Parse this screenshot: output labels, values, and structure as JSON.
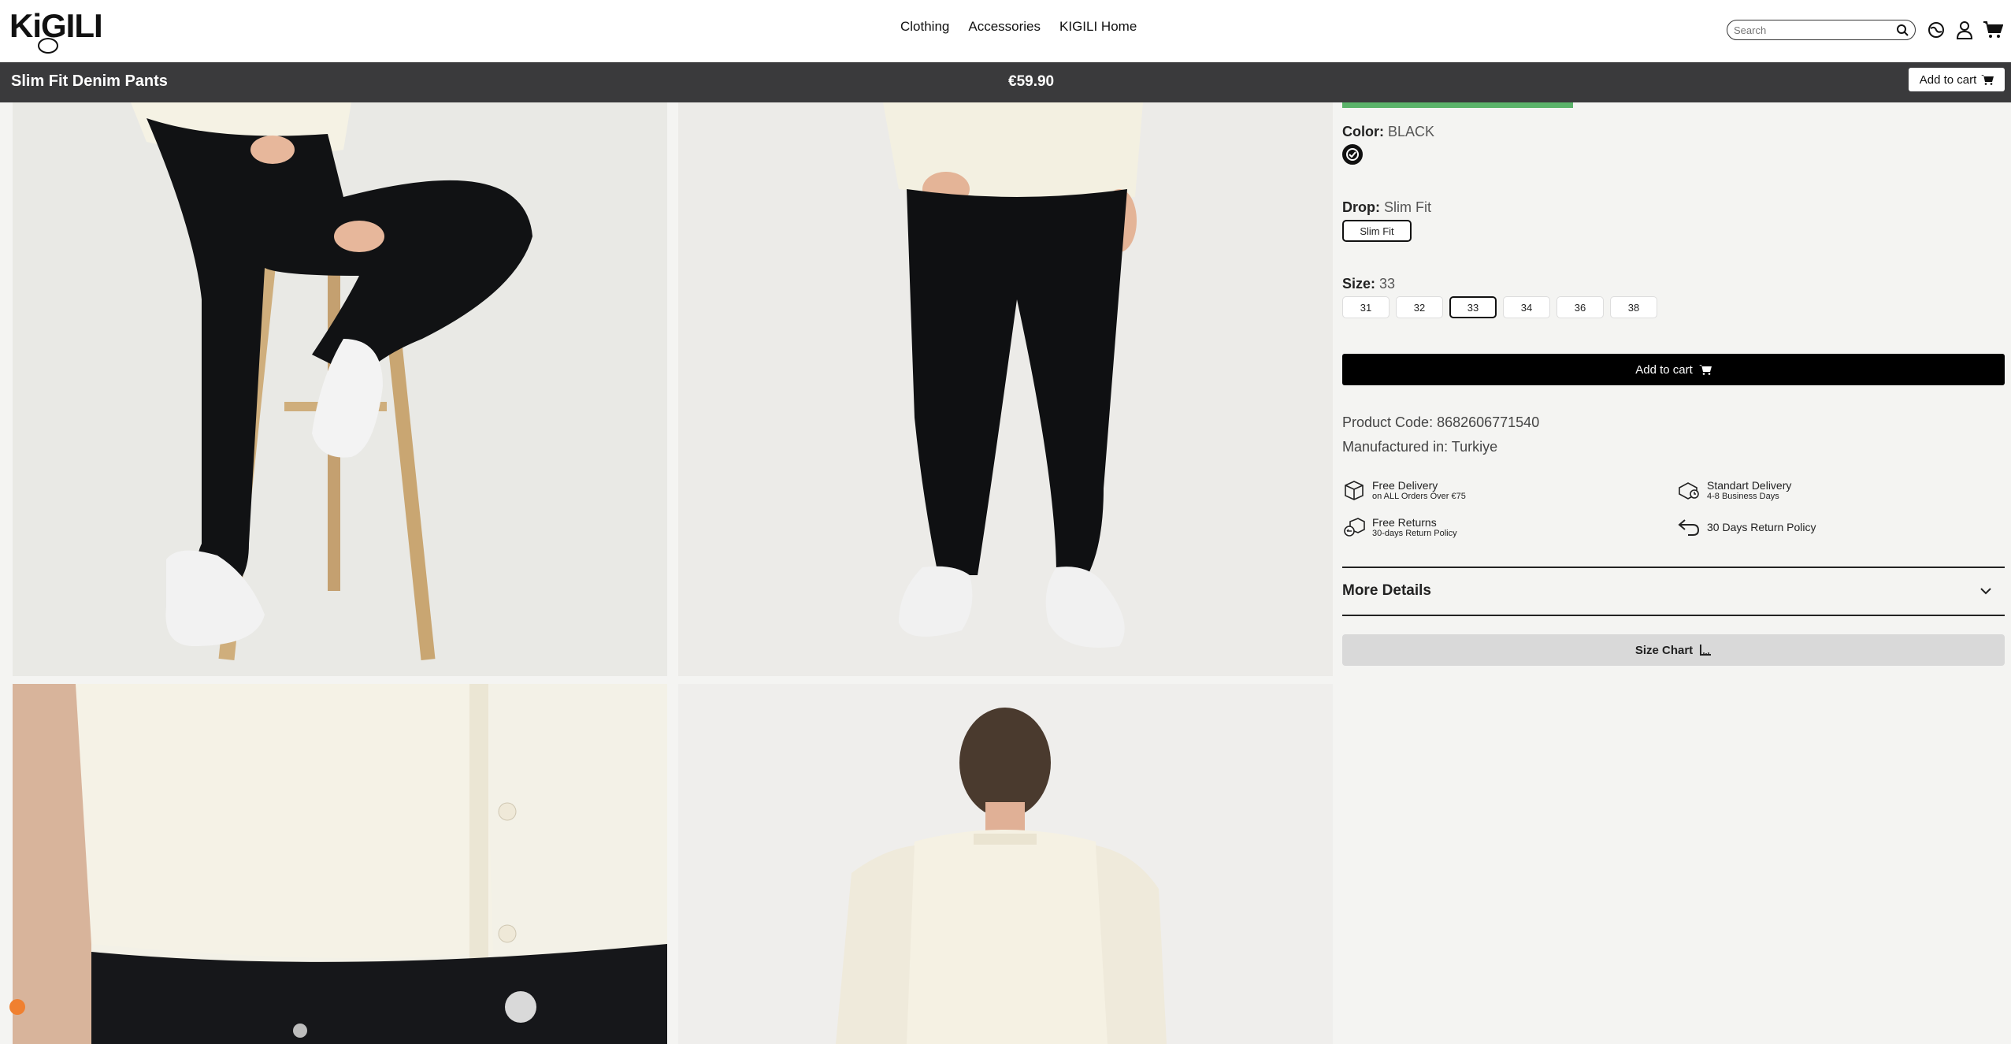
{
  "header": {
    "logo_text": "KiGILI",
    "nav": [
      "Clothing",
      "Accessories",
      "KIGILI Home"
    ],
    "search_placeholder": "Search"
  },
  "sticky": {
    "title": "Slim Fit Denim Pants",
    "price": "€59.90",
    "add_to_cart": "Add to cart"
  },
  "product": {
    "color_label": "Color:",
    "color_value": "BLACK",
    "drop_label": "Drop:",
    "drop_value": "Slim Fit",
    "drop_option": "Slim Fit",
    "size_label": "Size:",
    "size_value": "33",
    "sizes": [
      "31",
      "32",
      "33",
      "34",
      "36",
      "38"
    ],
    "selected_size": "33",
    "add_to_cart": "Add to cart",
    "product_code": "Product Code: 8682606771540",
    "manufactured": "Manufactured in: Turkiye"
  },
  "features": [
    {
      "title": "Free Delivery",
      "sub": "on ALL Orders Over €75",
      "icon": "box-icon"
    },
    {
      "title": "Standart Delivery",
      "sub": "4-8 Business Days",
      "icon": "delivery-icon"
    },
    {
      "title": "Free Returns",
      "sub": "30-days Return Policy",
      "icon": "return-box-icon"
    },
    {
      "title": "30 Days Return Policy",
      "sub": "",
      "icon": "return-arrow-icon"
    }
  ],
  "more_details": "More Details",
  "size_chart": "Size Chart",
  "colors": {
    "accent": "#5bb36a",
    "bar": "#3a3a3c",
    "cta": "#000000"
  }
}
